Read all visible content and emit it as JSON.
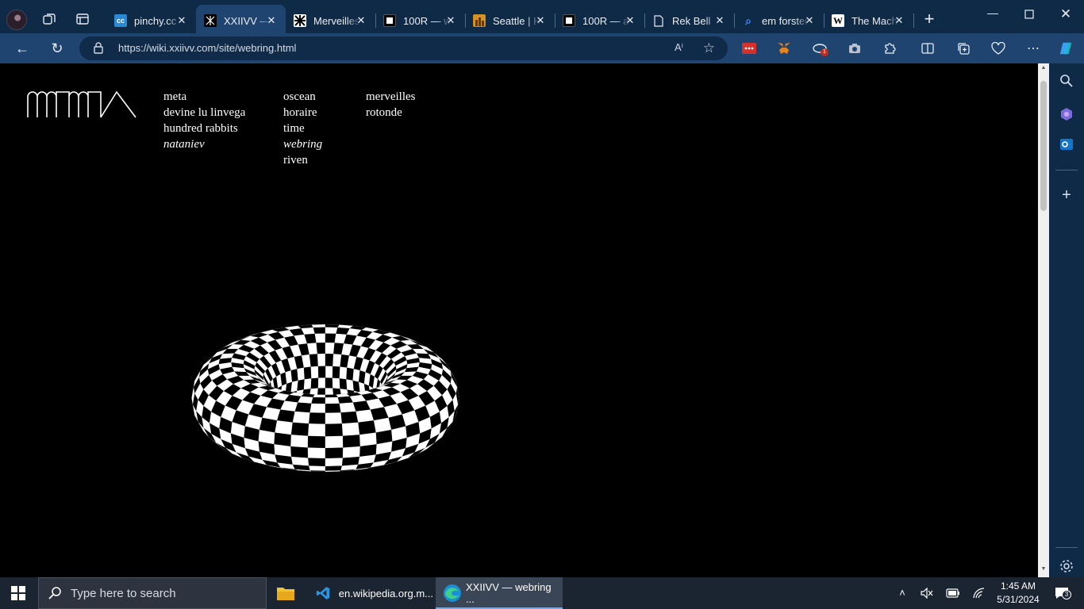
{
  "browser": {
    "tabs": [
      {
        "title": "pinchy.cc",
        "favicon": "cc",
        "color": "#2a8ad6"
      },
      {
        "title": "XXIIVV — webring",
        "favicon": "xxiivv",
        "color": "#000000"
      },
      {
        "title": "Merveilles",
        "favicon": "merveilles",
        "color": "#ffffff"
      },
      {
        "title": "100R — w",
        "favicon": "100r",
        "color": "#000000"
      },
      {
        "title": "Seattle | H",
        "favicon": "seattle",
        "color": "#c98a1e"
      },
      {
        "title": "100R — a",
        "favicon": "100r",
        "color": "#000000"
      },
      {
        "title": "Rek Bell",
        "favicon": "page",
        "color": "#e8edf3"
      },
      {
        "title": "em forster",
        "favicon": "search",
        "color": "#3d8bff"
      },
      {
        "title": "The Mach",
        "favicon": "wikipedia",
        "color": "#ffffff"
      }
    ],
    "url": "https://wiki.xxiivv.com/site/webring.html",
    "extension_badge": "1"
  },
  "page": {
    "nav_columns": [
      {
        "links": [
          {
            "label": "meta",
            "current": false
          },
          {
            "label": "devine lu linvega",
            "current": false
          },
          {
            "label": "hundred rabbits",
            "current": false
          },
          {
            "label": "nataniev",
            "current": true
          }
        ]
      },
      {
        "links": [
          {
            "label": "oscean",
            "current": false
          },
          {
            "label": "horaire",
            "current": false
          },
          {
            "label": "time",
            "current": false
          },
          {
            "label": "webring",
            "current": true
          },
          {
            "label": "riven",
            "current": false
          }
        ]
      },
      {
        "links": [
          {
            "label": "merveilles",
            "current": false
          },
          {
            "label": "rotonde",
            "current": false
          }
        ]
      }
    ]
  },
  "taskbar": {
    "search_placeholder": "Type here to search",
    "apps": [
      {
        "label": "en.wikipedia.org.m...",
        "icon": "vscode-icon"
      },
      {
        "label": "XXIIVV — webring ...",
        "icon": "edge-icon",
        "active": true
      }
    ],
    "time": "1:45 AM",
    "date": "5/31/2024",
    "notifications": "3"
  }
}
